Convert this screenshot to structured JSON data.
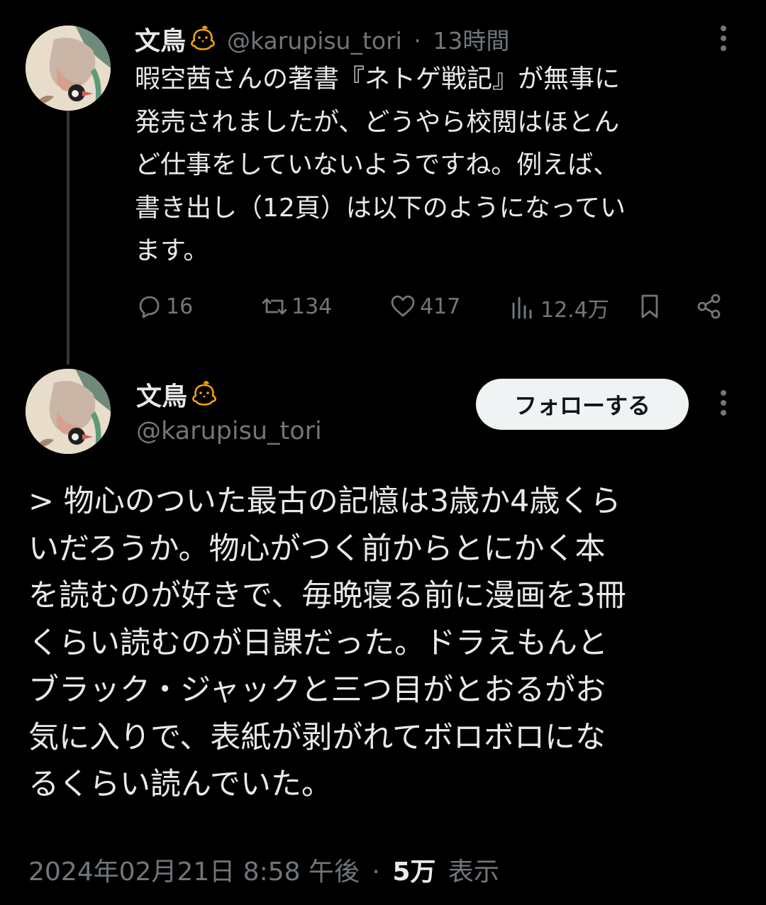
{
  "reply": {
    "display_name": "文鳥",
    "handle": "@karupisu_tori",
    "separator": "·",
    "time_ago": "13時間",
    "body_lines": [
      "暇空茜さんの著書『ネトゲ戦記』が無事に",
      "発売されましたが、どうやら校閲はほとん",
      "ど仕事をしていないようですね。例えば、",
      "書き出し（12頁）は以下のようになってい",
      "ます。"
    ],
    "actions": {
      "replies": "16",
      "reposts": "134",
      "likes": "417",
      "views": "12.4万"
    }
  },
  "main": {
    "display_name": "文鳥",
    "handle": "@karupisu_tori",
    "follow_label": "フォローする",
    "body_lines": [
      "> 物心のついた最古の記憶は3歳か4歳くら",
      "いだろうか。物心がつく前からとにかく本",
      "を読むのが好きで、毎晩寝る前に漫画を3冊",
      "くらい読むのが日課だった。ドラえもんと",
      "ブラック・ジャックと三つ目がとおるがお",
      "気に入りで、表紙が剥がれてボロボロにな",
      "るくらい読んでいた。"
    ],
    "timestamp": "2024年02月21日 8:58 午後",
    "separator": "·",
    "views_count": "5万",
    "views_label": "表示"
  },
  "icons": {
    "avatar": "avatar-bird-icon",
    "badge": "chick-icon",
    "more": "more-icon",
    "reply": "reply-icon",
    "repost": "repost-icon",
    "like": "heart-icon",
    "views": "views-icon",
    "bookmark": "bookmark-icon",
    "share": "share-icon"
  },
  "colors": {
    "background": "#000000",
    "text": "#e7e9ea",
    "muted": "#71767b",
    "badge": "#f4a20c",
    "follow_bg": "#eff3f4"
  }
}
